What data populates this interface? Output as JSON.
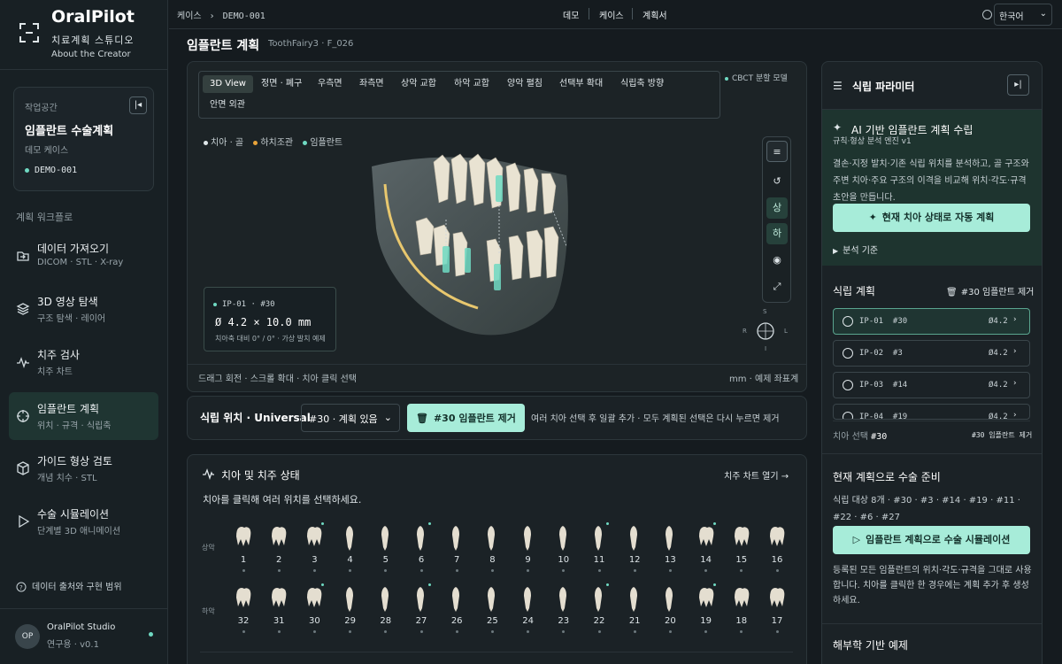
{
  "brand": {
    "name": "OralPilot",
    "subtitle": "치료계획 스튜디오",
    "link": "About the Creator"
  },
  "workspace": {
    "label": "작업공간",
    "title": "임플란트 수술계획",
    "case": "데모 케이스",
    "case_id": "DEMO-001"
  },
  "workflow": {
    "label": "계획 워크플로",
    "items": [
      {
        "title": "데이터 가져오기",
        "sub": "DICOM · STL · X-ray",
        "icon": "import-icon"
      },
      {
        "title": "3D 영상 탐색",
        "sub": "구조 탐색 · 레이어",
        "icon": "layers-icon"
      },
      {
        "title": "치주 검사",
        "sub": "치주 차트",
        "icon": "pulse-icon"
      },
      {
        "title": "임플란트 계획",
        "sub": "위치 · 규격 · 식립축",
        "icon": "target-icon"
      },
      {
        "title": "가이드 형상 검토",
        "sub": "개념 치수 · STL",
        "icon": "cube-icon"
      },
      {
        "title": "수술 시뮬레이션",
        "sub": "단계별 3D 애니메이션",
        "icon": "play-icon"
      }
    ]
  },
  "sidebar_footer": {
    "source": "데이터 출처와 구현 범위",
    "user_initials": "OP",
    "user_name": "OralPilot Studio",
    "user_ver": "연구용 · v0.1"
  },
  "topbar": {
    "crumb1": "케이스",
    "crumb2": "DEMO-001",
    "nav": [
      "데모",
      "케이스",
      "계획서"
    ],
    "lang": "한국어"
  },
  "page": {
    "title": "임플란트 계획",
    "sub": "ToothFairy3 · F_026"
  },
  "viewer": {
    "tabs": [
      "3D View",
      "정면 · 폐구",
      "우측면",
      "좌측면",
      "상악 교합",
      "하악 교합",
      "양악 펼침",
      "선택부 확대",
      "식립축 방향",
      "안면 외관"
    ],
    "status": "CBCT 분할 모델",
    "legend": [
      "치아 · 골",
      "하치조관",
      "임플란트"
    ],
    "tools": [
      "≡",
      "↺",
      "상",
      "하",
      "◉",
      "⤢"
    ],
    "orient": {
      "s": "S",
      "r": "R",
      "l": "L",
      "i": "I"
    },
    "info_head": "IP-01 · #30",
    "info_val": "Ø 4.2 × 10.0 mm",
    "info_sub": "치아축 대비 0° / 0° · 가상 발치 예제",
    "hint": "드래그 회전 · 스크롤 확대 · 치아 클릭 선택",
    "unit": "mm · 예제 좌표계"
  },
  "position": {
    "label": "식립 위치 · Universal",
    "select": "#30 · 계획 있음",
    "remove": "#30 임플란트 제거",
    "hint": "여러 치아 선택 후 일괄 추가 · 모두 계획된 선택은 다시 누르면 제거"
  },
  "teeth": {
    "title": "치아 및 치주 상태",
    "open": "치주 차트 열기 →",
    "desc": "치아를 클릭해 여러 위치를 선택하세요.",
    "upper_label": "상악",
    "lower_label": "하악",
    "upper": [
      "1",
      "2",
      "3",
      "4",
      "5",
      "6",
      "7",
      "8",
      "9",
      "10",
      "11",
      "12",
      "13",
      "14",
      "15",
      "16"
    ],
    "lower": [
      "32",
      "31",
      "30",
      "29",
      "28",
      "27",
      "26",
      "25",
      "24",
      "23",
      "22",
      "21",
      "20",
      "19",
      "18",
      "17"
    ]
  },
  "panel": {
    "title": "식립 파라미터",
    "ai_title": "AI 기반 임플란트 계획 수립",
    "ai_sub": "규칙·형상 분석 엔진 v1",
    "ai_desc": "결손·지정 발치·기존 식립 위치를 분석하고, 골 구조와 주변 치아·주요 구조의 이격을 비교해 위치·각도·규격 초안을 만듭니다.",
    "ai_btn": "현재 치아 상태로 자동 계획",
    "ai_crit": "분석 기준",
    "plan_title": "식립 계획",
    "plan_remove": "#30 임플란트 제거",
    "implants": [
      {
        "id": "IP-01",
        "tooth": "#30",
        "size": "Ø4.2"
      },
      {
        "id": "IP-02",
        "tooth": "#3",
        "size": "Ø4.2"
      },
      {
        "id": "IP-03",
        "tooth": "#14",
        "size": "Ø4.2"
      },
      {
        "id": "IP-04",
        "tooth": "#19",
        "size": "Ø4.2"
      }
    ],
    "tooth_sel_label": "치아 선택",
    "tooth_sel_val": "#30",
    "tooth_sel_right": "#30 임플란트 제거",
    "surg_title": "현재 계획으로 수술 준비",
    "surg_desc": "식립 대상 8개 · #30 · #3 · #14 · #19 · #11 · #22 · #6 · #27",
    "surg_btn": "임플란트 계획으로 수술 시뮬레이션",
    "surg_note": "등록된 모든 임플란트의 위치·각도·규격을 그대로 사용합니다. 치아를 클릭한 한 경우에는 계획 추가 후 생성하세요.",
    "anat_title": "해부학 기반 예제"
  }
}
